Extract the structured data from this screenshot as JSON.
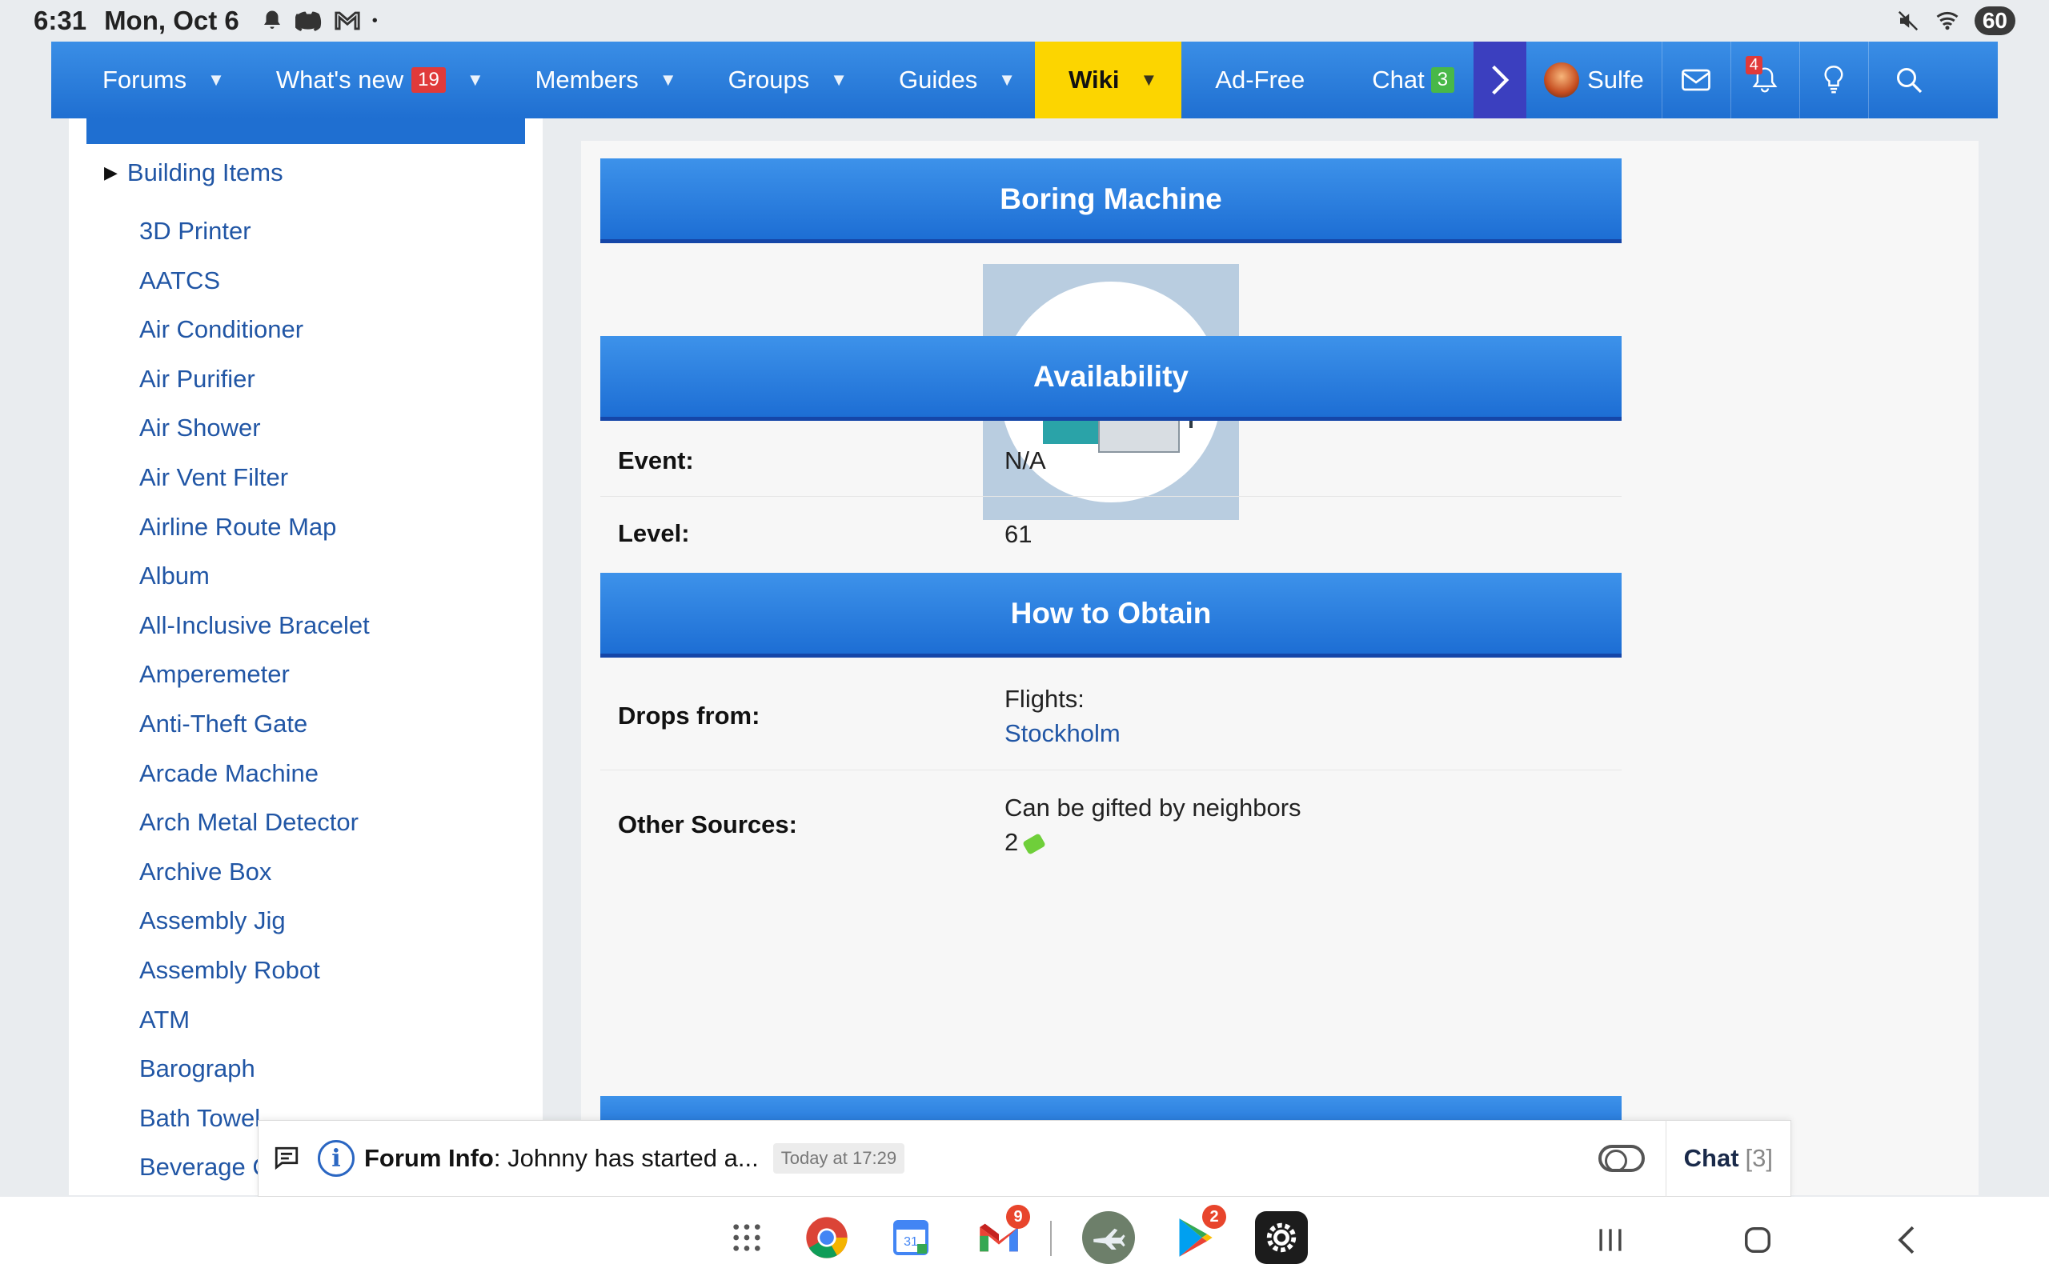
{
  "status_bar": {
    "time": "6:31",
    "date": "Mon, Oct 6",
    "battery": "60"
  },
  "navbar": {
    "items": [
      {
        "label": "Forums"
      },
      {
        "label": "What's new",
        "badge": "19"
      },
      {
        "label": "Members"
      },
      {
        "label": "Groups"
      },
      {
        "label": "Guides"
      }
    ],
    "wiki_label": "Wiki",
    "adfree_label": "Ad-Free",
    "chat_label": "Chat",
    "chat_badge": "3",
    "user_name": "Sulfe",
    "alerts_badge": "4"
  },
  "sidebar": {
    "group_label": "Building Items",
    "items": [
      "3D Printer",
      "AATCS",
      "Air Conditioner",
      "Air Purifier",
      "Air Shower",
      "Air Vent Filter",
      "Airline Route Map",
      "Album",
      "All-Inclusive Bracelet",
      "Amperemeter",
      "Anti-Theft Gate",
      "Arcade Machine",
      "Arch Metal Detector",
      "Archive Box",
      "Assembly Jig",
      "Assembly Robot",
      "ATM",
      "Barograph",
      "Bath Towel",
      "Beverage C"
    ]
  },
  "main": {
    "item_title": "Boring Machine",
    "availability_title": "Availability",
    "event_label": "Event:",
    "event_value": "N/A",
    "level_label": "Level:",
    "level_value": "61",
    "obtain_title": "How to Obtain",
    "drops_label": "Drops from:",
    "drops_prefix": "Flights:",
    "drops_link": "Stockholm",
    "other_label": "Other Sources:",
    "other_value": "Can be gifted by neighbors",
    "other_amount": "2"
  },
  "notice": {
    "title": "Forum Info",
    "text": ": Johnny has started a...",
    "time": "Today at 17:29",
    "chat_label": "Chat",
    "chat_count": "[3]"
  },
  "dock": {
    "gmail_badge": "9",
    "play_badge": "2"
  },
  "colors": {
    "nav_blue": "#1f6fd1",
    "wiki_yellow": "#fcd500",
    "link": "#2156a5"
  }
}
